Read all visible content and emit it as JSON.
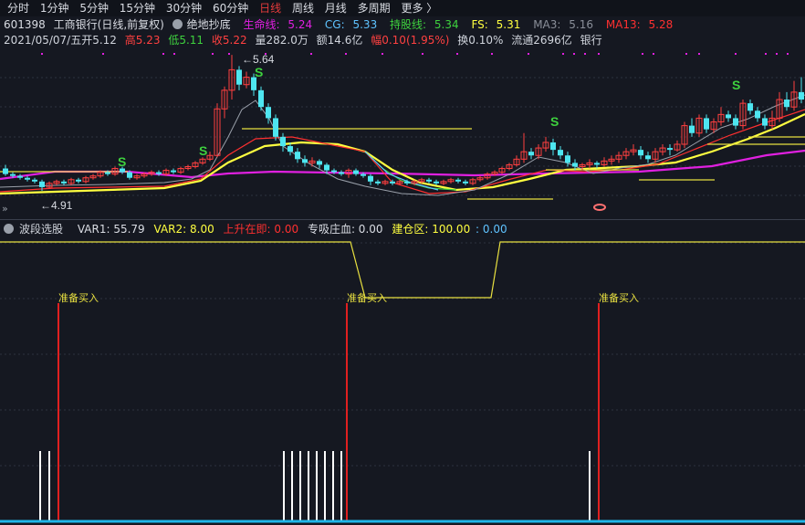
{
  "periods": [
    "分时",
    "1分钟",
    "5分钟",
    "15分钟",
    "30分钟",
    "60分钟",
    "日线",
    "周线",
    "月线",
    "多周期",
    "更多 〉"
  ],
  "active_period": "日线",
  "header": {
    "code": "601398",
    "name": "工商银行(日线,前复权)",
    "formula": "绝地抄底",
    "lifeline_label": "生命线:",
    "lifeline_value": "5.24",
    "cg_label": "CG:",
    "cg_value": "5.33",
    "hold_label": "持股线:",
    "hold_value": "5.34",
    "fs_label": "FS:",
    "fs_value": "5.31",
    "ma3_label": "MA3:",
    "ma3_value": "5.16",
    "ma13_label": "MA13:",
    "ma13_value": "5.28"
  },
  "quote": {
    "date": "2021/05/07/五",
    "open": "开5.12",
    "high": "高5.23",
    "low": "低5.11",
    "close": "收5.22",
    "volume": "量282.0万",
    "amount": "额14.6亿",
    "amp": "幅0.10(1.95%)",
    "turnover": "换0.10%",
    "float": "流通2696亿",
    "industry": "银行"
  },
  "annotations": {
    "high_price": "5.64",
    "low_price": "4.91",
    "signal": "S",
    "buy_label": "准备买入"
  },
  "indicator": {
    "name": "波段选股",
    "var1": "VAR1: 55.79",
    "var2": "VAR2: 8.00",
    "rising": "上升在即: 0.00",
    "dealer": "专吸庄血: 0.00",
    "build": "建仓区: 100.00",
    "extra": ": 0.00"
  },
  "colors": {
    "up": "#ff4040",
    "down": "#4ee6f0",
    "lifeline": "#e020e0",
    "cg": "#5fc3ff",
    "hold": "#3ed13e",
    "fs": "#ffff40",
    "ma13": "#ff3030",
    "bg": "#151821"
  }
}
